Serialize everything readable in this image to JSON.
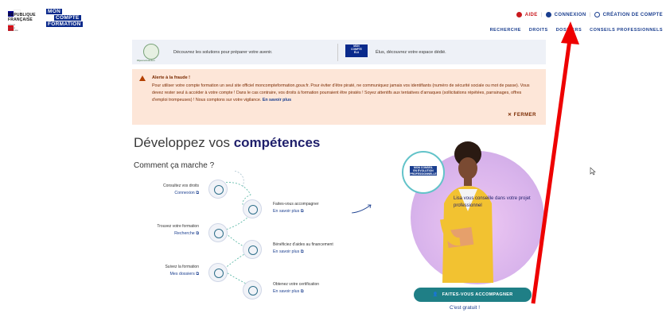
{
  "header": {
    "republique": [
      "RÉPUBLIQUE",
      "FRANÇAISE"
    ],
    "devise": [
      "Liberté",
      "Égalité",
      "Fraternité"
    ],
    "logo_lines": [
      "MON",
      "COMPTE",
      "FORMATION"
    ],
    "aide": "AIDE",
    "connexion": "CONNEXION",
    "creation": "CRÉATION DE COMPTE",
    "nav": [
      "RECHERCHE",
      "DROITS",
      "DOSSIERS",
      "CONSEILS PROFESSIONNELS"
    ]
  },
  "strip": {
    "left_text": "Découvrez les solutions pour préparer votre avenir.",
    "left_logo_caption": "#1jeune1solution",
    "right_logo": [
      "MON",
      "COMPTE",
      "ÉLU"
    ],
    "right_text": "Élus, découvrez votre espace dédié."
  },
  "alert": {
    "title": "Alerte à la fraude !",
    "body": "Pour utiliser votre compte formation un seul site officiel moncompteformation.gouv.fr. Pour éviter d'être piraté, ne communiquez jamais vos identifiants (numéro de sécurité sociale ou mot de passe). Vous devez rester seul à accéder à votre compte ! Dans le cas contraire, vos droits à formation pourraient être piratés ! Soyez attentifs aux tentatives d'arnaques (sollicitations répétées, parrainages, offres d'emploi trompeuses) ! Nous comptons sur votre vigilance.",
    "more": "En savoir plus",
    "close": "FERMER"
  },
  "main": {
    "title_prefix": "Développez vos",
    "title_bold": "compétences",
    "subtitle": "Comment ça marche ?"
  },
  "steps_left": [
    {
      "label": "Consultez vos droits",
      "link": "Connexion"
    },
    {
      "label": "Trouvez votre formation",
      "link": "Recherche"
    },
    {
      "label": "Suivez la formation",
      "link": "Mes dossiers"
    }
  ],
  "steps_right": [
    {
      "label": "Faites-vous accompagner",
      "link": "En savoir plus"
    },
    {
      "label": "Bénéficiez d'aides au financement",
      "link": "En savoir plus"
    },
    {
      "label": "Obtenez votre certification",
      "link": "En savoir plus"
    }
  ],
  "lisa": {
    "badge": [
      "MON CONSEIL",
      "EN ÉVOLUTION",
      "PROFESSIONNELLE"
    ],
    "bubble": "Lisa vous conseille dans votre projet professionnel",
    "cta": "FAITES-VOUS ACCOMPAGNER",
    "free": "C'est gratuit !"
  },
  "colors": {
    "accent": "#1a3e8f",
    "alert_bg": "#fde6d8",
    "cta": "#1f7f86",
    "arrow": "#ee0000"
  }
}
